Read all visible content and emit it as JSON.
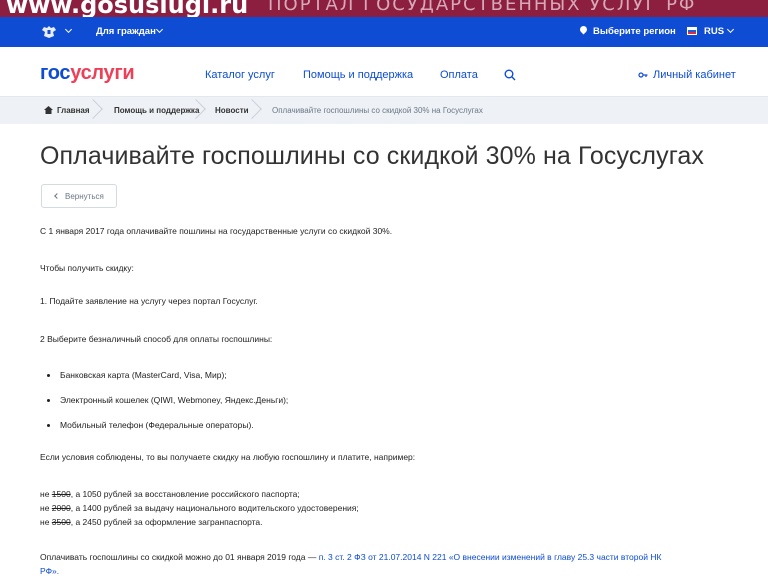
{
  "banner": {
    "site": "www.gosuslugi.ru",
    "tagline": "ПОРТАЛ ГОСУДАРСТВЕННЫХ УСЛУГ РФ"
  },
  "topbar": {
    "citizens_label": "Для граждан",
    "region_label": "Выберите регион",
    "lang_label": "RUS"
  },
  "header": {
    "logo_part1": "гос",
    "logo_part2": "услуги",
    "nav": [
      "Каталог услуг",
      "Помощь и поддержка",
      "Оплата"
    ],
    "cabinet_label": "Личный кабинет"
  },
  "breadcrumbs": {
    "items": [
      "Главная",
      "Помощь и поддержка",
      "Новости"
    ],
    "current": "Оплачивайте госпошлины со скидкой 30% на Госуслугах"
  },
  "page": {
    "title": "Оплачивайте госпошлины со скидкой 30% на Госуслугах",
    "back_label": "Вернуться",
    "intro": "С 1 января 2017 года оплачивайте пошлины на государственные услуги со скидкой 30%.",
    "how_to": "Чтобы получить скидку:",
    "step1": "1. Подайте заявление на услугу через портал Госуслуг.",
    "step2": "2  Выберите безналичный способ для оплаты госпошлины:",
    "methods": [
      "Банковская карта (MasterCard, Visa, Мир);",
      "Электронный кошелек (QIWI, Webmoney, Яндекс.Деньги);",
      "Мобильный телефон (Федеральные операторы)."
    ],
    "conditions": "Если условия соблюдены, то вы получаете скидку на любую госпошлину и платите, например:",
    "examples": [
      {
        "prefix": "не ",
        "old": "1500",
        "rest": ", а 1050 рублей за восстановление российского паспорта;"
      },
      {
        "prefix": "не ",
        "old": "2000",
        "rest": ", а 1400 рублей за выдачу национального водительского удостоверения;"
      },
      {
        "prefix": "не ",
        "old": "3500",
        "rest": ", а 2450 рублей за оформление загранпаспорта."
      }
    ],
    "deadline_text": "Оплачивать госпошлины со скидкой можно до 01 января 2019 года — ",
    "deadline_link_1": "п. 3 ст. 2 ФЗ от 21.07.2014 N 221 «О внесении изменений в главу 25.3 части второй НК",
    "deadline_link_2": "РФ»."
  },
  "colors": {
    "brand_blue": "#0d4cd3",
    "brand_red": "#ee3f58",
    "banner": "#8c1f3f"
  },
  "icons": [
    "emblem-icon",
    "chevron-down-icon",
    "location-pin-icon",
    "flag-icon",
    "search-icon",
    "key-icon",
    "home-icon",
    "chevron-left-icon"
  ]
}
